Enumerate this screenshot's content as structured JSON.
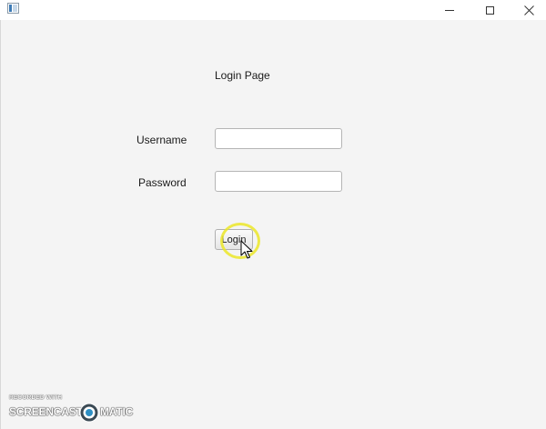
{
  "window": {
    "title": ""
  },
  "page": {
    "title": "Login Page"
  },
  "form": {
    "username_label": "Username",
    "username_value": "",
    "password_label": "Password",
    "password_value": "",
    "login_label": "Login"
  },
  "watermark": {
    "line1": "RECORDED WITH",
    "brand_left": "SCREENCAST",
    "brand_right": "MATIC"
  },
  "icons": {
    "app": "app-window-icon",
    "minimize": "minimize-icon",
    "maximize": "maximize-icon",
    "close": "close-icon",
    "cursor": "mouse-pointer-icon"
  },
  "colors": {
    "background": "#f4f4f4",
    "click_highlight": "#ebe628"
  }
}
